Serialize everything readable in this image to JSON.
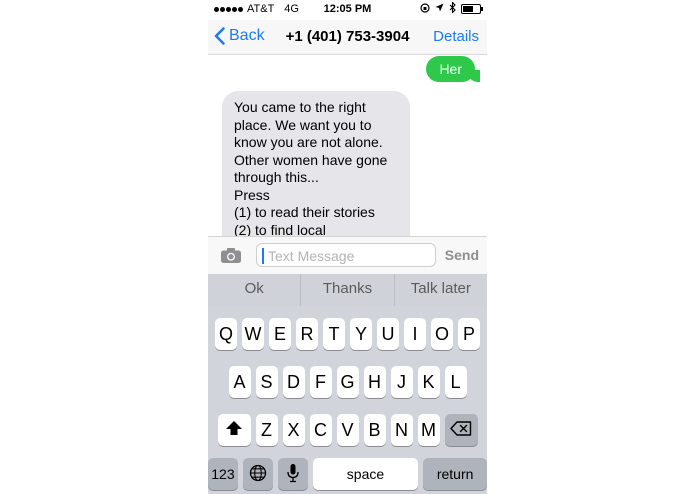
{
  "status_bar": {
    "carrier": "AT&T",
    "network": "4G",
    "time": "12:05 PM"
  },
  "nav": {
    "back_label": "Back",
    "title": "+1 (401) 753-3904",
    "details_label": "Details"
  },
  "conversation": {
    "outgoing": "Her",
    "incoming_lines": [
      "You came to the right",
      "place. We want you to",
      "know you are not alone.",
      "Other women have gone",
      "through this...",
      "Press",
      "(1) to read their stories",
      "(2) to find local"
    ]
  },
  "composer": {
    "placeholder": "Text Message",
    "value": "",
    "send_label": "Send"
  },
  "keyboard": {
    "predictions": [
      "Ok",
      "Thanks",
      "Talk later"
    ],
    "row1": [
      "Q",
      "W",
      "E",
      "R",
      "T",
      "Y",
      "U",
      "I",
      "O",
      "P"
    ],
    "row2": [
      "A",
      "S",
      "D",
      "F",
      "G",
      "H",
      "J",
      "K",
      "L"
    ],
    "row3": [
      "Z",
      "X",
      "C",
      "V",
      "B",
      "N",
      "M"
    ],
    "numbers_label": "123",
    "space_label": "space",
    "return_label": "return"
  },
  "colors": {
    "ios_blue": "#1a7cf5",
    "sent_green": "#2ec84b",
    "received_gray": "#e5e5ea"
  }
}
